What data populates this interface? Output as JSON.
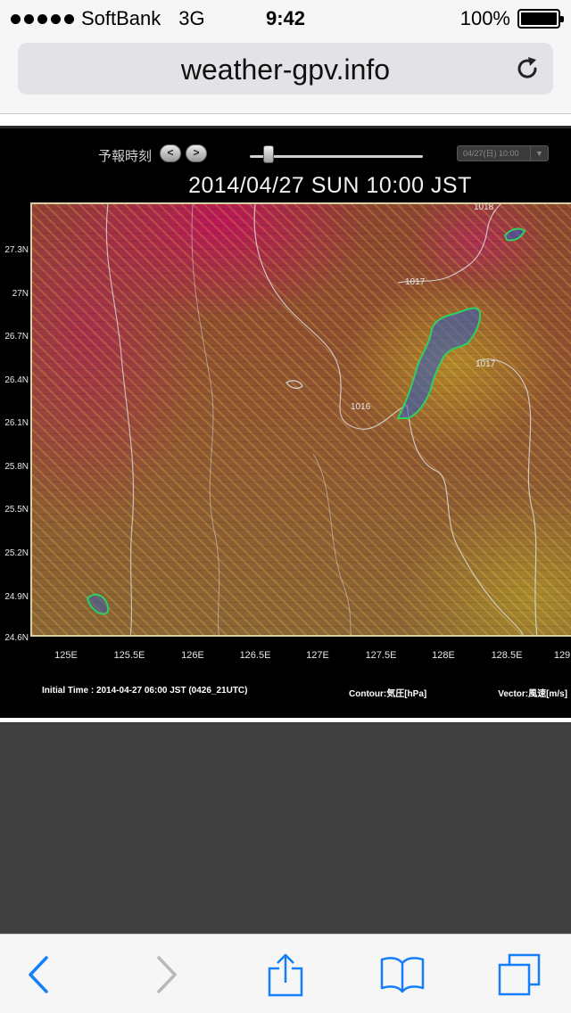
{
  "status_bar": {
    "carrier": "SoftBank",
    "network": "3G",
    "time": "9:42",
    "battery_text": "100%",
    "battery_level": 1.0
  },
  "address_bar": {
    "url": "weather-gpv.info",
    "reload_icon": "reload-icon"
  },
  "viewer": {
    "forecast_label": "予報時刻",
    "prev_label": "<",
    "next_label": ">",
    "slider_level": 0.1,
    "time_select_value": "04/27(日) 10:00",
    "title": "2014/04/27 SUN  10:00 JST",
    "lat_labels": [
      "27.3N",
      "27N",
      "26.7N",
      "26.4N",
      "26.1N",
      "25.8N",
      "25.5N",
      "25.2N",
      "24.9N",
      "24.6N"
    ],
    "lon_labels": [
      "125E",
      "125.5E",
      "126E",
      "126.5E",
      "127E",
      "127.5E",
      "128E",
      "128.5E",
      "129"
    ],
    "contour_labels": [
      "1018",
      "1017",
      "1017",
      "1016"
    ],
    "initial_time": "Initial Time : 2014-04-27 06:00 JST (0426_21UTC)",
    "contour_legend": "Contour:気圧[hPa]",
    "vector_legend": "Vector:風速[m/s]"
  },
  "toolbar": {
    "back_icon": "chevron-left-icon",
    "forward_icon": "chevron-right-icon",
    "share_icon": "share-icon",
    "bookmarks_icon": "book-icon",
    "tabs_icon": "tabs-icon"
  },
  "colors": {
    "ios_blue": "#157efb",
    "disabled_gray": "#b9b9bd"
  }
}
